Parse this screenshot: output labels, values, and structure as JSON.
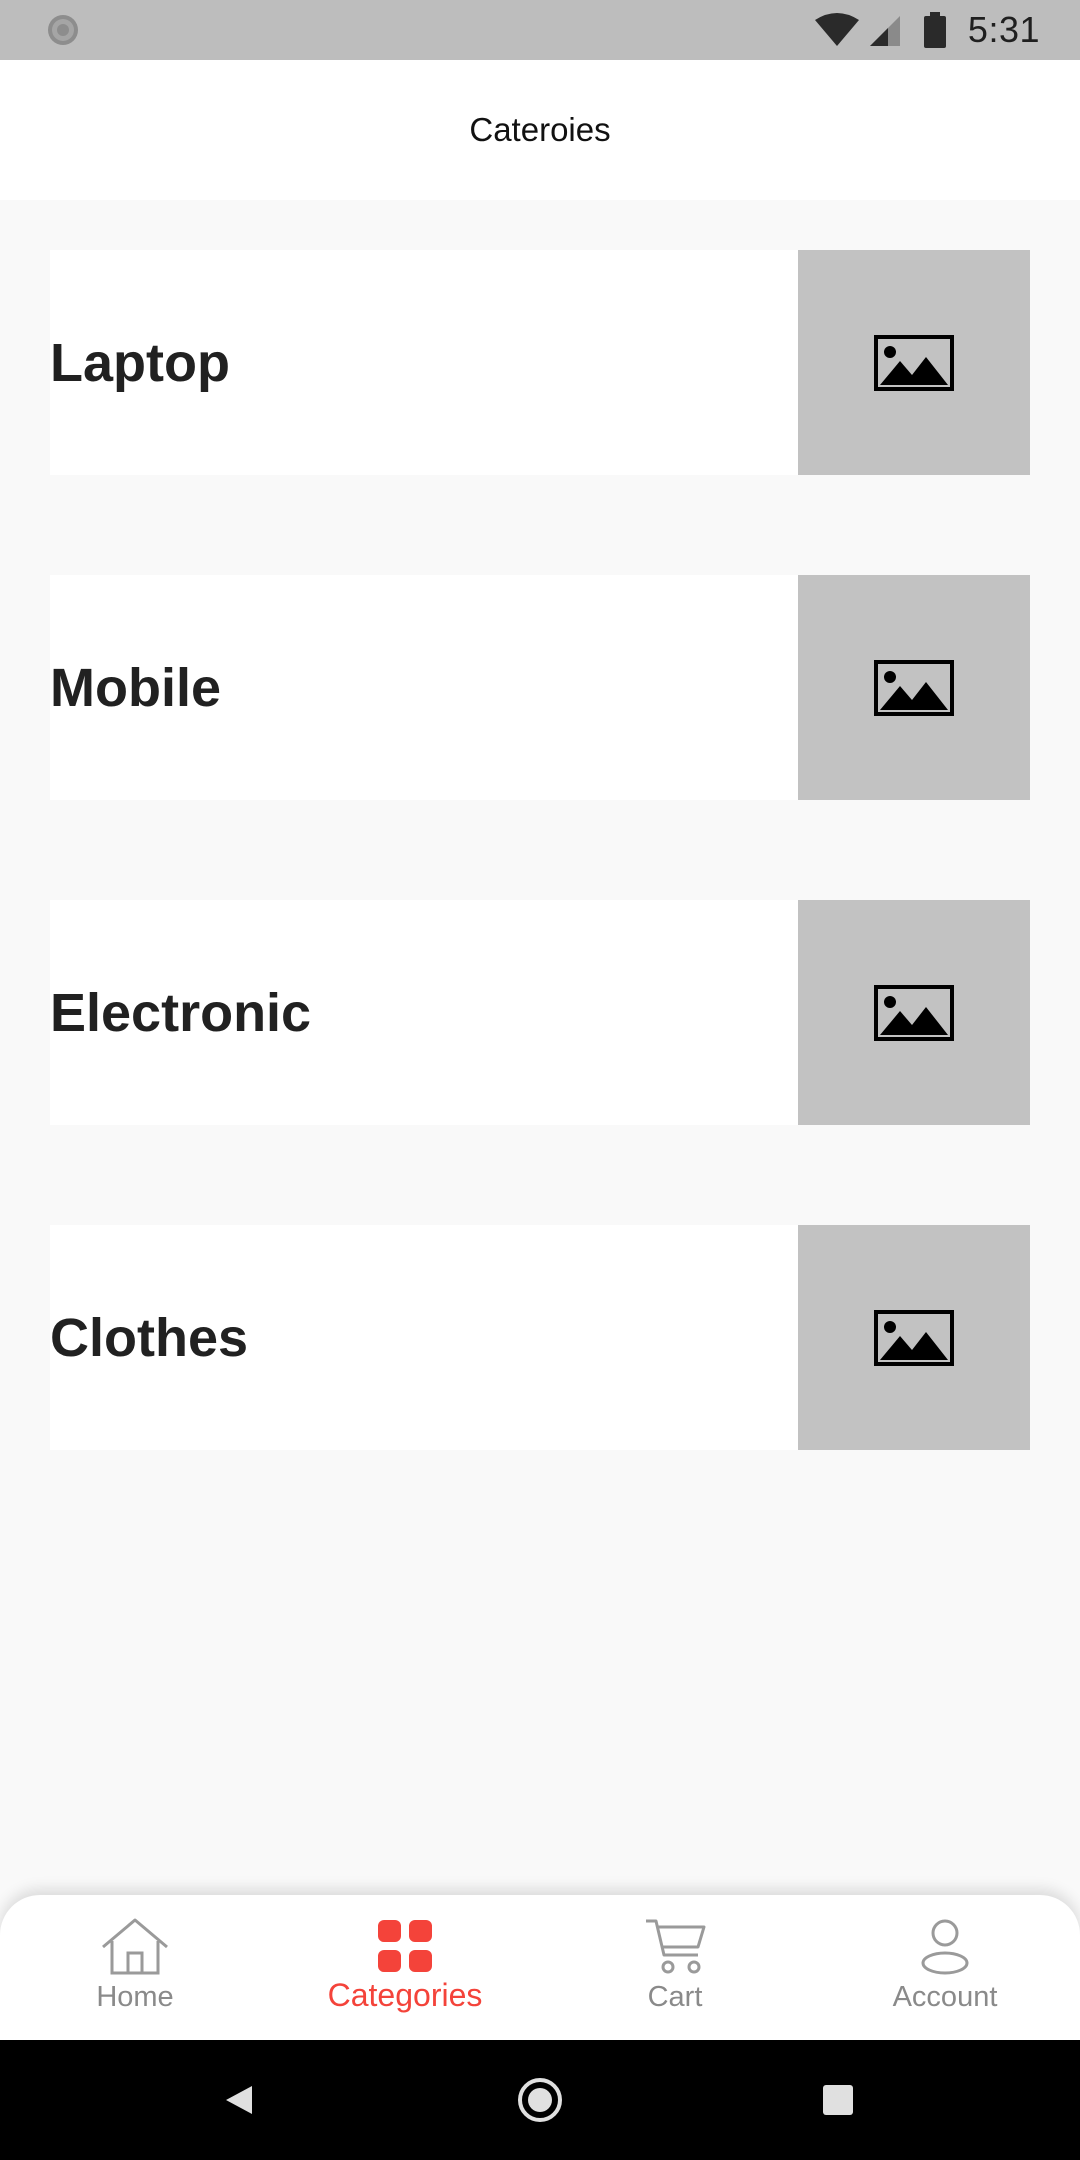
{
  "status_bar": {
    "time": "5:31",
    "icons": [
      "sync-icon",
      "wifi-icon",
      "signal-icon",
      "battery-icon"
    ]
  },
  "app_bar": {
    "title": "Cateroies"
  },
  "categories": [
    {
      "name": "Laptop",
      "image_icon": "image-placeholder-icon"
    },
    {
      "name": "Mobile",
      "image_icon": "image-placeholder-icon"
    },
    {
      "name": "Electronic",
      "image_icon": "image-placeholder-icon"
    },
    {
      "name": "Clothes",
      "image_icon": "image-placeholder-icon"
    }
  ],
  "bottom_nav": {
    "items": [
      {
        "label": "Home",
        "icon": "home-icon",
        "active": false
      },
      {
        "label": "Categories",
        "icon": "categories-grid-icon",
        "active": true
      },
      {
        "label": "Cart",
        "icon": "cart-icon",
        "active": false
      },
      {
        "label": "Account",
        "icon": "account-icon",
        "active": false
      }
    ]
  },
  "colors": {
    "accent": "#f4433a",
    "inactive": "#8a8a8a",
    "status_bar": "#bdbdbd",
    "background": "#f9f9f9",
    "image_placeholder": "#c2c2c2"
  }
}
